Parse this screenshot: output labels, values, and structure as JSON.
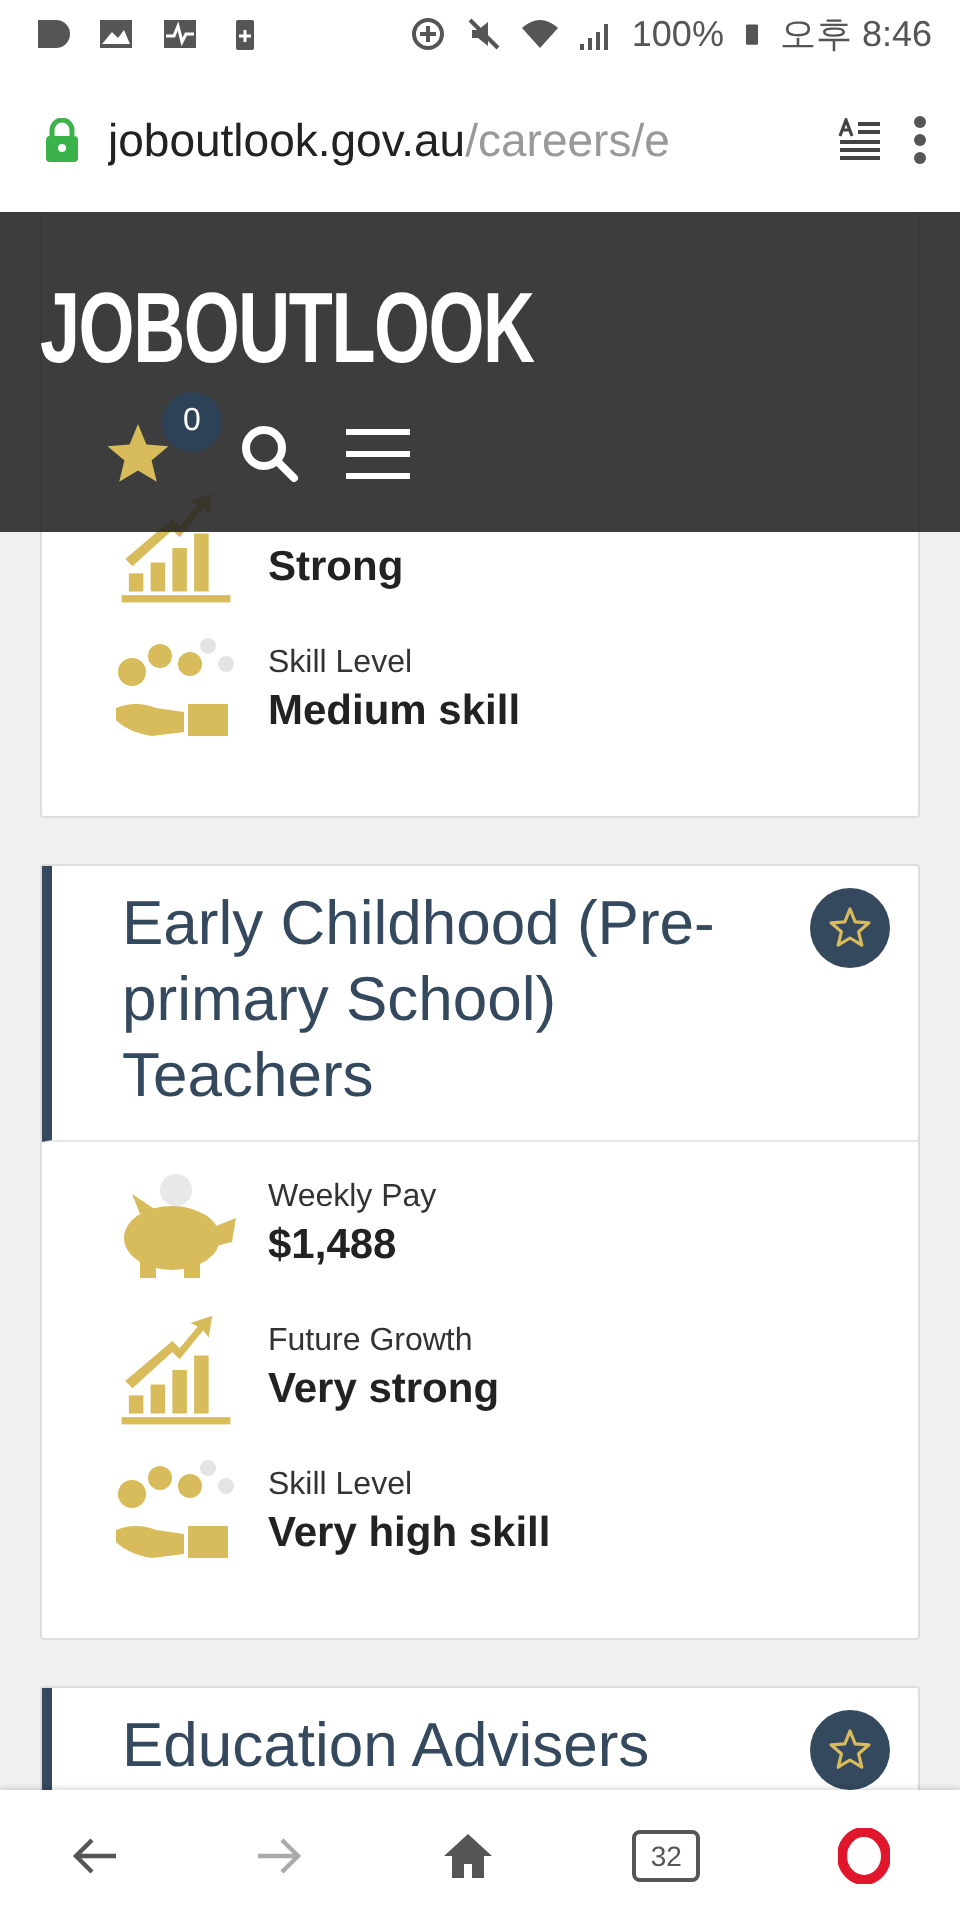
{
  "status_bar": {
    "battery": "100%",
    "time": "오후 8:46"
  },
  "address_bar": {
    "domain": "joboutlook.gov.au",
    "path": "/careers/e"
  },
  "header": {
    "logo": "JOBOUTLOOK",
    "shortlist_count": "0"
  },
  "careers": [
    {
      "stats": [
        {
          "kind": "growth",
          "value": "Strong"
        },
        {
          "kind": "skill",
          "label": "Skill Level",
          "value": "Medium skill"
        }
      ]
    },
    {
      "title": "Early Childhood (Pre-primary School) Teachers",
      "saved": false,
      "stats": [
        {
          "kind": "pay",
          "label": "Weekly Pay",
          "value": "$1,488"
        },
        {
          "kind": "growth",
          "label": "Future Growth",
          "value": "Very strong"
        },
        {
          "kind": "skill",
          "label": "Skill Level",
          "value": "Very high skill"
        }
      ]
    },
    {
      "title": "Education Advisers",
      "saved": false
    }
  ],
  "bottom_nav": {
    "tab_count": "32",
    "forward_disabled": true
  }
}
